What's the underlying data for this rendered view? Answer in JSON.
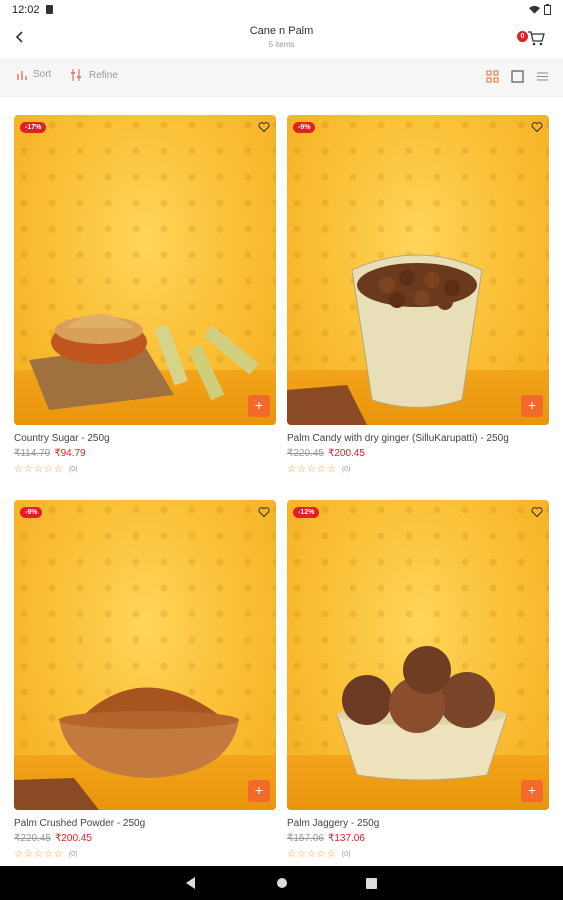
{
  "status": {
    "time": "12:02"
  },
  "header": {
    "title": "Cane n Palm",
    "subtitle": "5 items",
    "cart_count": "0"
  },
  "toolbar": {
    "sort_label": "Sort",
    "refine_label": "Refine"
  },
  "products": [
    {
      "discount": "-17%",
      "name": "Country Sugar -   250g",
      "old_price": "₹114.79",
      "price": "₹94.79",
      "reviews": "(0)"
    },
    {
      "discount": "-9%",
      "name": "Palm Candy with dry ginger (SilluKarupatti) -   250g",
      "old_price": "₹220.45",
      "price": "₹200.45",
      "reviews": "(0)"
    },
    {
      "discount": "-9%",
      "name": "Palm Crushed Powder -   250g",
      "old_price": "₹220.45",
      "price": "₹200.45",
      "reviews": "(0)"
    },
    {
      "discount": "-12%",
      "name": "Palm Jaggery -   250g",
      "old_price": "₹157.06",
      "price": "₹137.06",
      "reviews": "(0)"
    }
  ],
  "colors": {
    "accent": "#f06a2a",
    "badge": "#e31e24",
    "product_bg": "#fbc23a"
  }
}
